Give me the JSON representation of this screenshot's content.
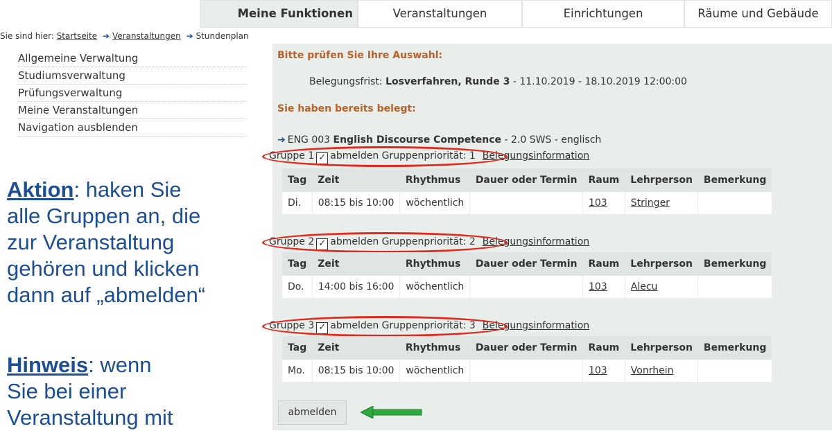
{
  "tabs": [
    "Meine Funktionen",
    "Veranstaltungen",
    "Einrichtungen",
    "Räume und Gebäude"
  ],
  "breadcrumb": {
    "prefix": "Sie sind hier:",
    "items": [
      "Startseite",
      "Veranstaltungen"
    ],
    "current": "Stundenplan"
  },
  "sidebar": [
    "Allgemeine Verwaltung",
    "Studiumsverwaltung",
    "Prüfungsverwaltung",
    "Meine Veranstaltungen",
    "Navigation ausblenden"
  ],
  "instruction": {
    "aktion_label": "Aktion",
    "aktion_lines": [
      ": haken Sie",
      "alle Gruppen an, die",
      "zur Veranstaltung",
      "gehören und klicken",
      "dann auf „abmelden“"
    ],
    "hinweis_label": "Hinweis",
    "hinweis_lines": [
      ": wenn",
      "Sie bei einer",
      "Veranstaltung mit"
    ]
  },
  "check_msg": "Bitte prüfen Sie Ihre Auswahl:",
  "frist": {
    "label": "Belegungsfrist: ",
    "name": "Losverfahren, Runde 3",
    "dates": " - 11.10.2019 - 18.10.2019 12:00:00"
  },
  "belegt_msg": "Sie haben bereits belegt:",
  "course": {
    "code": "ENG 003 ",
    "title": "English Discourse Competence",
    "suffix": " - 2.0 SWS   - englisch"
  },
  "table_headers": [
    "Tag",
    "Zeit",
    "Rhythmus",
    "Dauer oder Termin",
    "Raum",
    "Lehrperson",
    "Bemerkung"
  ],
  "groups": [
    {
      "label": "Gruppe 1",
      "check": "✓",
      "action": "abmelden",
      "priority": "Gruppenpriorität: 1",
      "info": "Belegungsinformation",
      "row": [
        "Di.",
        "08:15 bis 10:00",
        "wöchentlich",
        "",
        "103",
        "Stringer",
        ""
      ]
    },
    {
      "label": "Gruppe 2",
      "check": "✓",
      "action": "abmelden",
      "priority": "Gruppenpriorität: 2",
      "info": "Belegungsinformation",
      "row": [
        "Do.",
        "14:00 bis 16:00",
        "wöchentlich",
        "",
        "103",
        "Alecu",
        ""
      ]
    },
    {
      "label": "Gruppe 3",
      "check": "✓",
      "action": "abmelden",
      "priority": "Gruppenpriorität: 3",
      "info": "Belegungsinformation",
      "row": [
        "Mo.",
        "08:15 bis 10:00",
        "wöchentlich",
        "",
        "103",
        "Vonrhein",
        ""
      ]
    }
  ],
  "submit_label": "abmelden",
  "colors": {
    "annotation_text": "#1c4e95",
    "highlight_ellipse": "#e12a1f",
    "arrow_green": "#2eaa3e",
    "content_bg": "#e9eeea",
    "heading_orange": "#b7612b"
  }
}
